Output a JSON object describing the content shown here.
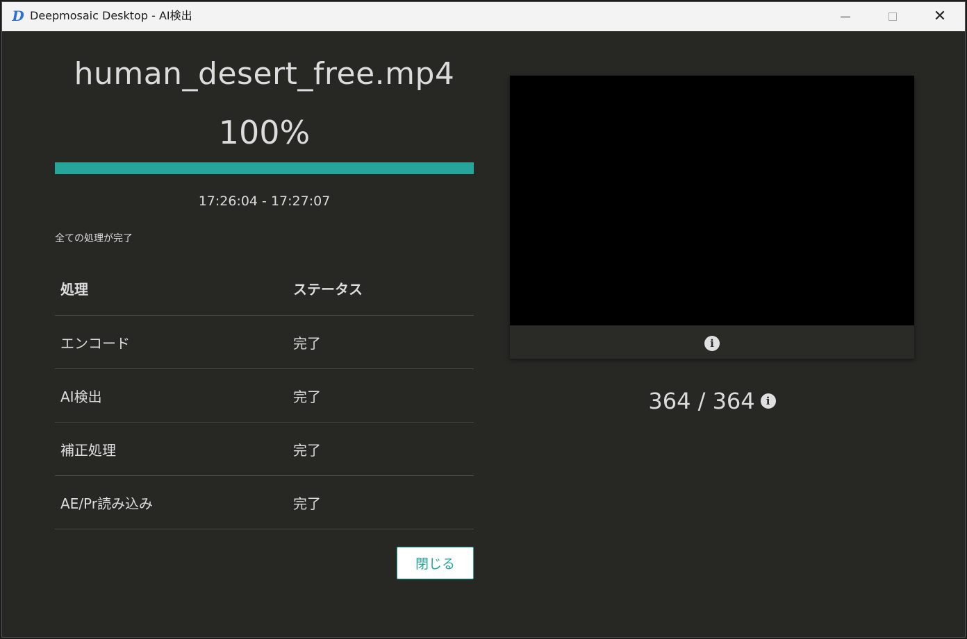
{
  "window": {
    "title": "Deepmosaic Desktop - AI検出",
    "app_icon_letter": "D"
  },
  "job": {
    "file_name": "human_desert_free.mp4",
    "progress_percent": 100,
    "progress_label": "100%",
    "time_range": "17:26:04 - 17:27:07",
    "status_message": "全ての処理が完了"
  },
  "table": {
    "headers": [
      "処理",
      "ステータス"
    ],
    "rows": [
      {
        "process": "エンコード",
        "status": "完了"
      },
      {
        "process": "AI検出",
        "status": "完了"
      },
      {
        "process": "補正処理",
        "status": "完了"
      },
      {
        "process": "AE/Pr読み込み",
        "status": "完了"
      }
    ]
  },
  "close_button_label": "閉じる",
  "preview": {
    "frame_counter": "364 / 364"
  },
  "colors": {
    "accent": "#26a69a",
    "background": "#272724"
  }
}
